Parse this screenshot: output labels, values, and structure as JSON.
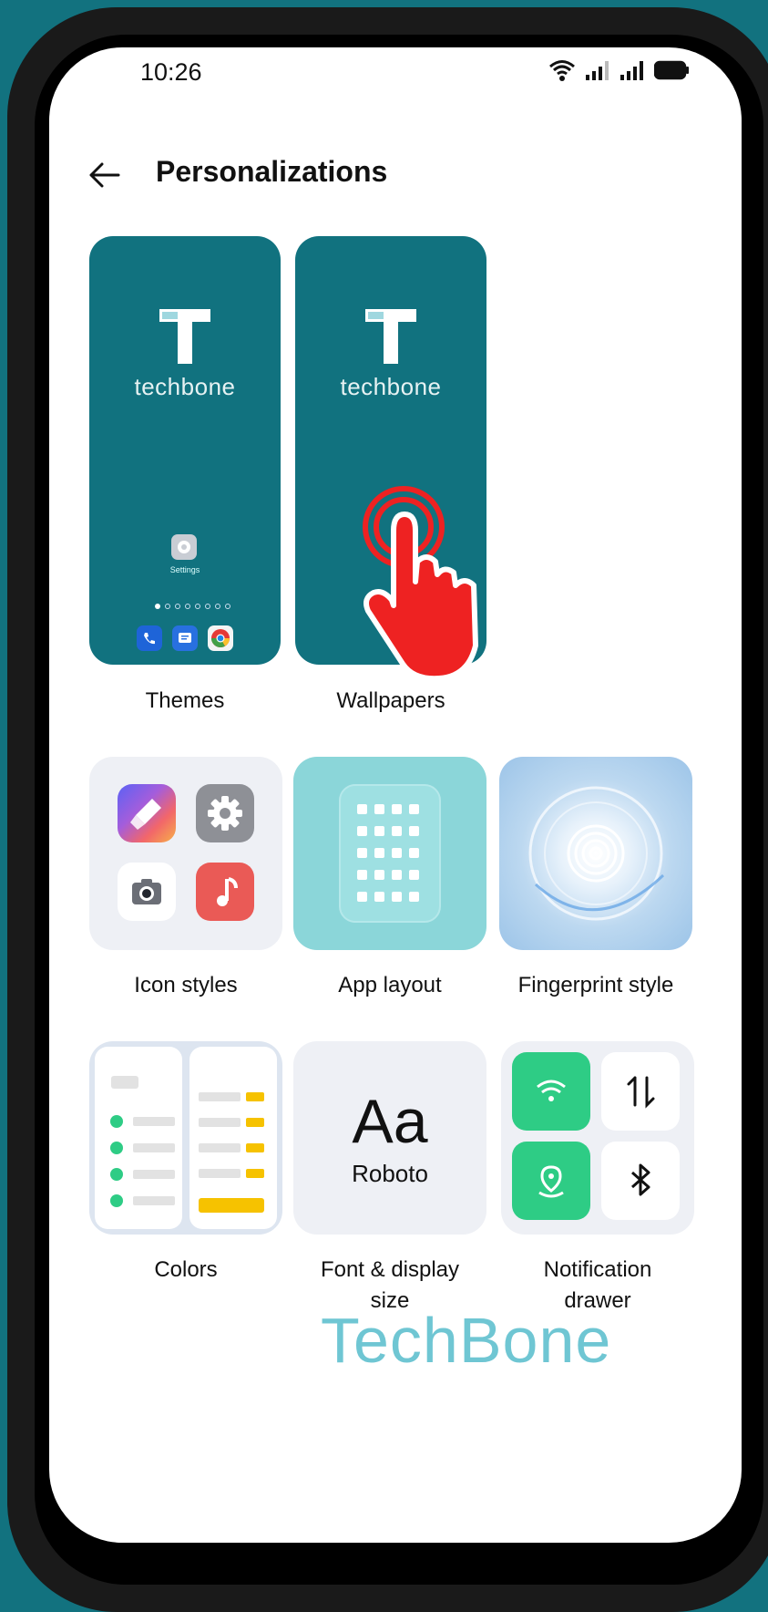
{
  "status_bar": {
    "time": "10:26"
  },
  "header": {
    "title": "Personalizations"
  },
  "tiles": {
    "themes": {
      "label": "Themes",
      "logo_word": "techbone",
      "settings_caption": "Settings"
    },
    "wallpapers": {
      "label": "Wallpapers",
      "logo_word": "techbone"
    },
    "icon_styles": {
      "label": "Icon styles"
    },
    "app_layout": {
      "label": "App layout"
    },
    "fingerprint_style": {
      "label": "Fingerprint style"
    },
    "colors": {
      "label": "Colors"
    },
    "font_display": {
      "label_line1": "Font & display",
      "label_line2": "size",
      "preview_big": "Aa",
      "preview_font": "Roboto"
    },
    "notification_drawer": {
      "label_line1": "Notification",
      "label_line2": "drawer"
    }
  },
  "watermark": {
    "text": "TechBone"
  },
  "colors": {
    "brand_teal": "#11727f",
    "accent_green": "#2ecc85",
    "pointer_red": "#ee2222",
    "watermark": "#6fc6d3"
  }
}
